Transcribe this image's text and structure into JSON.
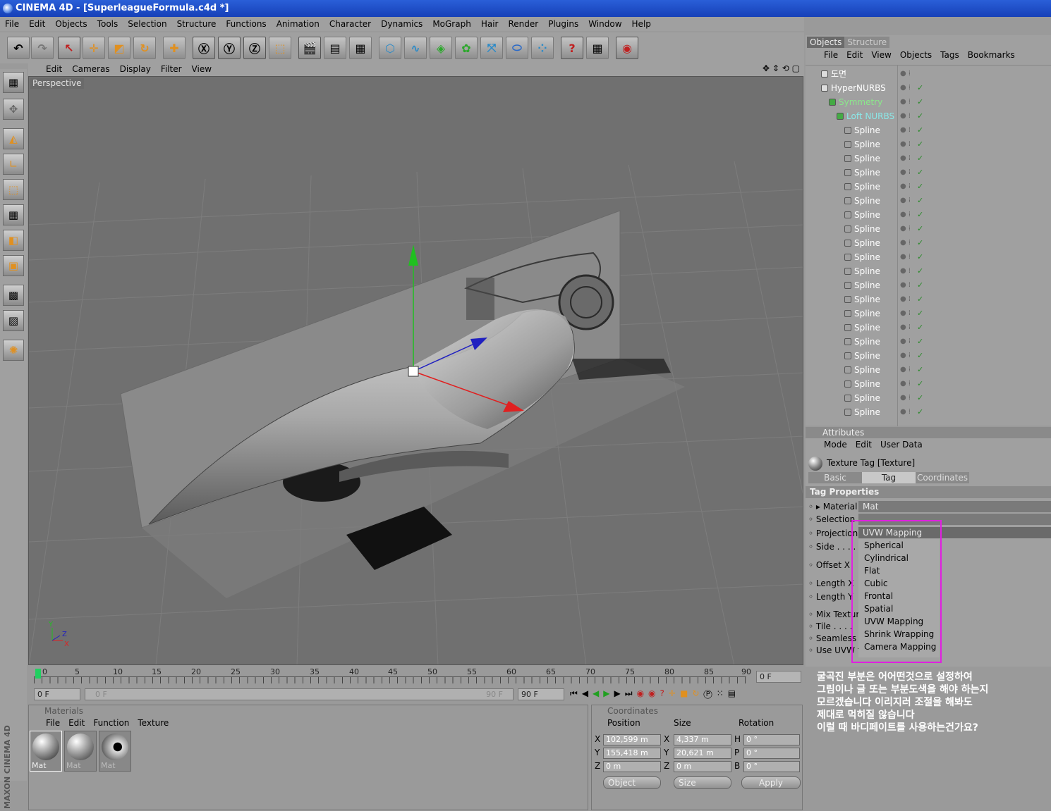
{
  "window": {
    "title": "CINEMA 4D - [SuperleagueFormula.c4d *]"
  },
  "menubar": [
    "File",
    "Edit",
    "Objects",
    "Tools",
    "Selection",
    "Structure",
    "Functions",
    "Animation",
    "Character",
    "Dynamics",
    "MoGraph",
    "Hair",
    "Render",
    "Plugins",
    "Window",
    "Help"
  ],
  "viewport": {
    "menu": [
      "Edit",
      "Cameras",
      "Display",
      "Filter",
      "View"
    ],
    "label": "Perspective",
    "axis_labels": {
      "y": "Y",
      "z": "Z",
      "x": "X"
    }
  },
  "timeline": {
    "ticks": [
      "0",
      "5",
      "10",
      "15",
      "20",
      "25",
      "30",
      "35",
      "40",
      "45",
      "50",
      "55",
      "60",
      "65",
      "70",
      "75",
      "80",
      "85",
      "90"
    ],
    "current_frame": "0 F",
    "start_field": "0 F",
    "slider_start": "0 F",
    "slider_end": "90 F",
    "end_field": "90 F"
  },
  "materials": {
    "title": "Materials",
    "menu": [
      "File",
      "Edit",
      "Function",
      "Texture"
    ],
    "items": [
      "Mat",
      "Mat",
      "Mat"
    ]
  },
  "coordinates": {
    "title": "Coordinates",
    "headers": {
      "position": "Position",
      "size": "Size",
      "rotation": "Rotation"
    },
    "rows": [
      {
        "axis": "X",
        "pos": "102,599 m",
        "size_axis": "X",
        "size": "4,337 m",
        "rot_axis": "H",
        "rot": "0 °"
      },
      {
        "axis": "Y",
        "pos": "155,418 m",
        "size_axis": "Y",
        "size": "20,621 m",
        "rot_axis": "P",
        "rot": "0 °"
      },
      {
        "axis": "Z",
        "pos": "0 m",
        "size_axis": "Z",
        "size": "0 m",
        "rot_axis": "B",
        "rot": "0 °"
      }
    ],
    "mode_select": "Object",
    "size_select": "Size",
    "apply_label": "Apply"
  },
  "objects_panel": {
    "tabs": [
      "Objects",
      "Structure"
    ],
    "menu": [
      "File",
      "Edit",
      "View",
      "Objects",
      "Tags",
      "Bookmarks"
    ],
    "tree": [
      {
        "name": "도면",
        "depth": 0
      },
      {
        "name": "HyperNURBS",
        "depth": 0
      },
      {
        "name": "Symmetry",
        "depth": 1
      },
      {
        "name": "Loft NURBS",
        "depth": 2
      },
      {
        "name": "Spline",
        "depth": 3
      },
      {
        "name": "Spline",
        "depth": 3
      },
      {
        "name": "Spline",
        "depth": 3
      },
      {
        "name": "Spline",
        "depth": 3
      },
      {
        "name": "Spline",
        "depth": 3
      },
      {
        "name": "Spline",
        "depth": 3
      },
      {
        "name": "Spline",
        "depth": 3
      },
      {
        "name": "Spline",
        "depth": 3
      },
      {
        "name": "Spline",
        "depth": 3
      },
      {
        "name": "Spline",
        "depth": 3
      },
      {
        "name": "Spline",
        "depth": 3
      },
      {
        "name": "Spline",
        "depth": 3
      },
      {
        "name": "Spline",
        "depth": 3
      },
      {
        "name": "Spline",
        "depth": 3
      },
      {
        "name": "Spline",
        "depth": 3
      },
      {
        "name": "Spline",
        "depth": 3
      },
      {
        "name": "Spline",
        "depth": 3
      },
      {
        "name": "Spline",
        "depth": 3
      },
      {
        "name": "Spline",
        "depth": 3
      },
      {
        "name": "Spline",
        "depth": 3
      },
      {
        "name": "Spline",
        "depth": 3
      }
    ]
  },
  "attributes": {
    "title": "Attributes",
    "menu": [
      "Mode",
      "Edit",
      "User Data"
    ],
    "object_title": "Texture Tag [Texture]",
    "tabs": [
      "Basic",
      "Tag",
      "Coordinates"
    ],
    "section": "Tag Properties",
    "material_label": "Material",
    "material_value": "Mat",
    "labels": [
      "Selection",
      "Projection",
      "Side . . . .",
      "Offset X",
      "Length X",
      "Length Y",
      "Mix Textur",
      "Tile . . . .",
      "Seamless",
      "Use UVW f"
    ],
    "projection_value": "UVW Mapping",
    "projection_options": [
      "Spherical",
      "Cylindrical",
      "Flat",
      "Cubic",
      "Frontal",
      "Spatial",
      "UVW Mapping",
      "Shrink Wrapping",
      "Camera Mapping"
    ]
  },
  "note": "굴곡진 부분은 어어떤것으로 설정하여\n그림이나 글 또는 부분도색을 해야 하는지\n모르겠습니다 이리지러 조절을 해봐도\n제대로 먹히질 않습니다\n이럴 때 바디페이트를 사용하는건가요?",
  "branding": "MAXON CINEMA 4D",
  "colors": {
    "title_bar": "#1f4fc8",
    "highlight_box": "#e020e0",
    "panel_bg": "#a0a0a0",
    "viewport_bg": "#707070"
  }
}
